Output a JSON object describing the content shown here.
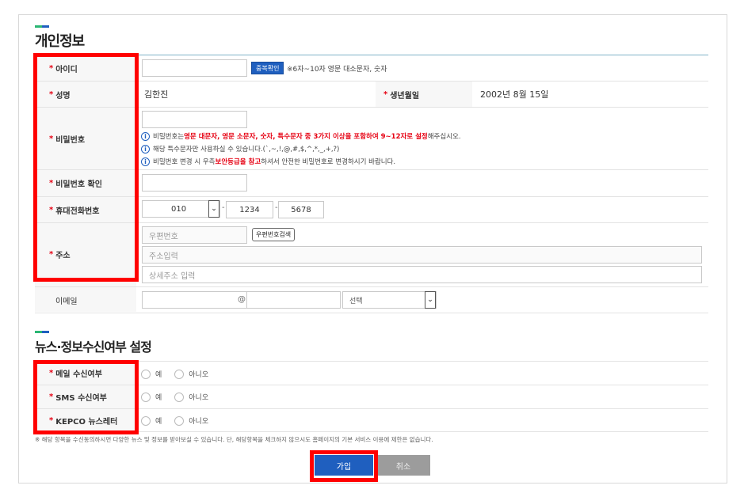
{
  "personal": {
    "title": "개인정보",
    "id_label": "아이디",
    "id_check_button": "중복확인",
    "id_hint": "※6자~10자 영문 대소문자, 숫자",
    "name_label": "성명",
    "name_value": "김한진",
    "birth_label": "생년월일",
    "birth_value": "2002년 8월 15일",
    "pw_label": "비밀번호",
    "pw_note1_pre": "비밀번호는 ",
    "pw_note1_red": "영문 대문자, 영문 소문자, 숫자, 특수문자 중 3가지 이상을 포함하여 9~12자로 설정",
    "pw_note1_post": "해주십시오.",
    "pw_note2": "해당 특수문자만 사용하실 수 있습니다.(`,~,!,@,#,$,^,*,_,+,?)",
    "pw_note3_pre": "비밀번호 변경 시 우측 ",
    "pw_note3_red": "보안등급을 참고",
    "pw_note3_post": "하셔서 안전한 비밀번호로 변경하시기 바랍니다.",
    "pw_confirm_label": "비밀번호 확인",
    "phone_label": "휴대전화번호",
    "phone_prefix": "010",
    "phone_mid": "1234",
    "phone_last": "5678",
    "phone_dash": "-",
    "address_label": "주소",
    "zipcode_placeholder": "우편번호",
    "zipcode_button": "우편번호검색",
    "address_placeholder": "주소입력",
    "address_detail_placeholder": "상세주소 입력",
    "email_label": "이메일",
    "email_at": "@",
    "email_domain_select": "선택",
    "required_mark": "*"
  },
  "news": {
    "title": "뉴스·정보수신여부 설정",
    "mail_label": "메일 수신여부",
    "sms_label": "SMS 수신여부",
    "kepco_label": "KEPCO 뉴스레터",
    "yes": "예",
    "no": "아니오",
    "footnote": "※ 해당 항목을 수신동의하시면 다양한 뉴스 및 정보를 받아보실 수 있습니다. 단, 해당항목을 체크하지 않으시도 홈페이지의 기본 서비스 이용에 제한은 없습니다."
  },
  "actions": {
    "join": "가입",
    "cancel": "취소"
  },
  "colors": {
    "accent_blue": "#1f5fbf",
    "required_red": "#e60012",
    "highlight_box": "#ff0000"
  }
}
